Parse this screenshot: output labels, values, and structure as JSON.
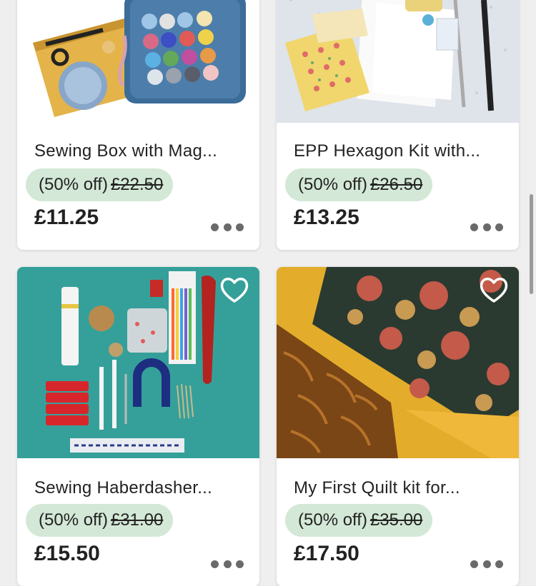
{
  "listings": [
    {
      "title": "Sewing Box with Mag...",
      "discount": "(50% off)",
      "original_price": "£22.50",
      "price": "£11.25",
      "image": "sewing-box-photo",
      "favorite_shown": false
    },
    {
      "title": "EPP Hexagon Kit with...",
      "discount": "(50% off)",
      "original_price": "£26.50",
      "price": "£13.25",
      "image": "hexagon-kit-photo",
      "favorite_shown": false
    },
    {
      "title": "Sewing Haberdasher...",
      "discount": "(50% off)",
      "original_price": "£31.00",
      "price": "£15.50",
      "image": "haberdashery-photo",
      "favorite_shown": true
    },
    {
      "title": "My First Quilt kit  for...",
      "discount": "(50% off)",
      "original_price": "£35.00",
      "price": "£17.50",
      "image": "quilt-fabric-photo",
      "favorite_shown": true
    }
  ],
  "colors": {
    "badge_bg": "#d3e8d6",
    "page_bg": "#efefef",
    "text": "#222222"
  }
}
